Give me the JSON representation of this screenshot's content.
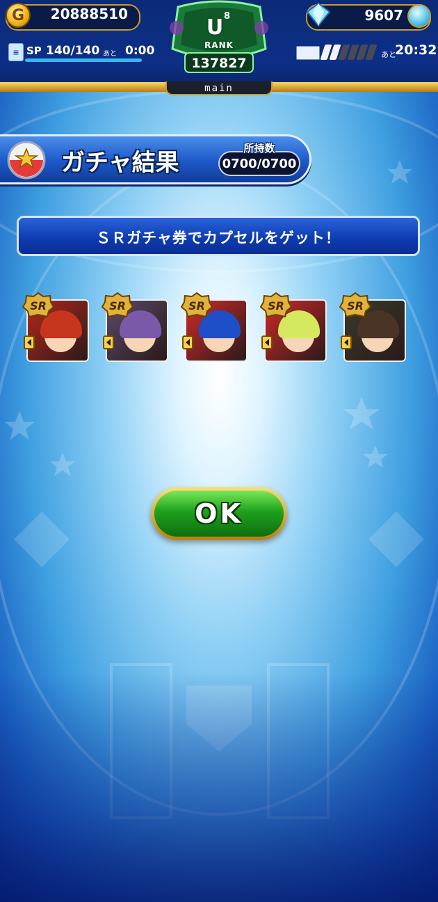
{
  "currency": {
    "coin_symbol": "G",
    "coins": "20888510",
    "gems": "9607"
  },
  "sp": {
    "label": "SP",
    "value": "140/140",
    "ato_label": "あと",
    "time": "0:00",
    "fill_fraction": 1.0
  },
  "rank": {
    "u_letter": "U",
    "superscript": "8",
    "rank_word": "RANK",
    "rank_value": "137827"
  },
  "server": {
    "label": "main"
  },
  "stamina": {
    "filled_segments": 2,
    "total_segments": 6,
    "ato_label": "あと",
    "time": "20:32"
  },
  "banner": {
    "title": "ガチャ結果",
    "owned_label": "所持数",
    "owned_value": "0700/0700"
  },
  "message": {
    "text": "ＳＲガチャ券でカプセルをゲット！"
  },
  "cards": [
    {
      "rarity": "SR",
      "hair_color": "#c8351e",
      "bg_color": "#b5281c"
    },
    {
      "rarity": "SR",
      "hair_color": "#7a5aa8",
      "bg_color": "#5a4a6a"
    },
    {
      "rarity": "SR",
      "hair_color": "#1f4fc8",
      "bg_color": "#d02a2a"
    },
    {
      "rarity": "SR",
      "hair_color": "#d6e860",
      "bg_color": "#d02a2a"
    },
    {
      "rarity": "SR",
      "hair_color": "#4a3426",
      "bg_color": "#3a3a2a"
    }
  ],
  "ok_button": {
    "label": "OK"
  },
  "colors": {
    "accent_gold": "#c79b2f",
    "ok_green": "#1fa11d",
    "banner_blue": "#1c58c8"
  }
}
